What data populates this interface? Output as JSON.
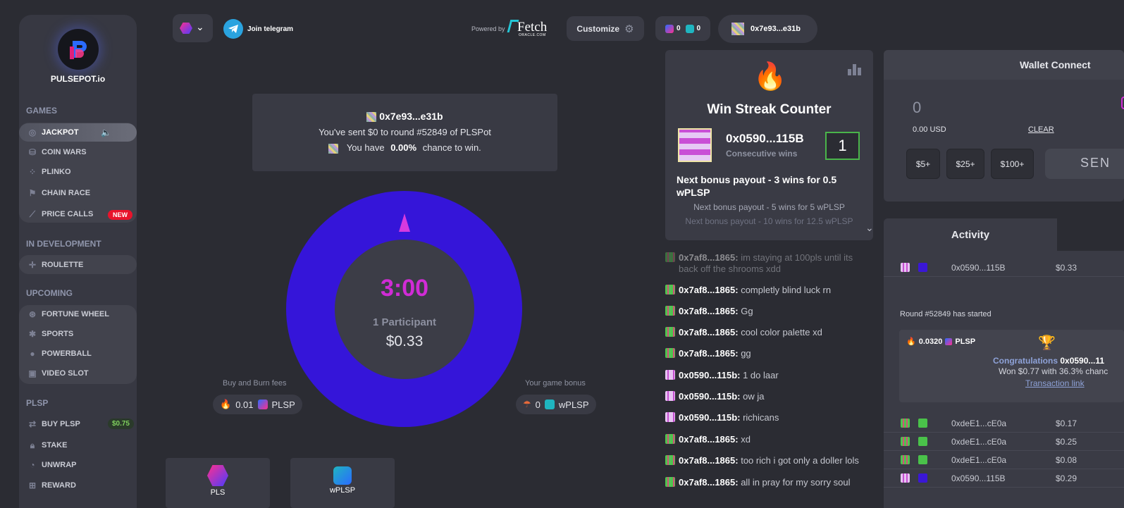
{
  "sidebar": {
    "brand": "PULSEPOT.io",
    "sections": {
      "games": "GAMES",
      "in_dev": "IN DEVELOPMENT",
      "upcoming": "UPCOMING",
      "plsp": "PLSP"
    },
    "games": [
      {
        "label": "JACKPOT",
        "icon": "target-icon"
      },
      {
        "label": "COIN WARS",
        "icon": "coin-icon"
      },
      {
        "label": "PLINKO",
        "icon": "plinko-icon"
      },
      {
        "label": "CHAIN RACE",
        "icon": "flag-icon"
      },
      {
        "label": "PRICE CALLS",
        "icon": "chart-icon",
        "badge": "NEW"
      }
    ],
    "in_dev": [
      {
        "label": "ROULETTE",
        "icon": "roulette-icon"
      }
    ],
    "upcoming": [
      {
        "label": "FORTUNE WHEEL",
        "icon": "wheel-icon"
      },
      {
        "label": "SPORTS",
        "icon": "runner-icon"
      },
      {
        "label": "POWERBALL",
        "icon": "ball-icon"
      },
      {
        "label": "VIDEO SLOT",
        "icon": "slot-icon"
      }
    ],
    "plsp": [
      {
        "label": "BUY PLSP",
        "icon": "buy-icon",
        "badge": "$0.75"
      },
      {
        "label": "STAKE",
        "icon": "lock-icon"
      },
      {
        "label": "UNWRAP",
        "icon": "unwrap-icon"
      },
      {
        "label": "REWARD",
        "icon": "gift-icon"
      }
    ]
  },
  "topbar": {
    "telegram": "Join telegram",
    "powered_by": "Powered by",
    "fetch": "Fetch",
    "fetch_sub": "ORACLE.COM",
    "customize": "Customize",
    "balance_plsp": "0",
    "balance_wplsp": "0",
    "wallet_address": "0x7e93...e31b"
  },
  "round": {
    "address": "0x7e93...e31b",
    "sent_text": "You've sent $0 to round #52849 of PLSPot",
    "have_prefix": "You have",
    "chance": "0.00%",
    "have_suffix": "chance to win."
  },
  "wheel": {
    "timer": "3:00",
    "participants": "1 Participant",
    "pot": "$0.33"
  },
  "fees": {
    "burn_label": "Buy and Burn fees",
    "burn_value": "0.01",
    "burn_token": "PLSP",
    "bonus_label": "Your game bonus",
    "bonus_value": "0",
    "bonus_token": "wPLSP"
  },
  "tokens": [
    {
      "label": "PLS"
    },
    {
      "label": "wPLSP"
    }
  ],
  "streak": {
    "title": "Win Streak Counter",
    "address": "0x0590...115B",
    "sub": "Consecutive wins",
    "count": "1",
    "next1": "Next bonus payout - 3 wins for 0.5 wPLSP",
    "next2": "Next bonus payout - 5 wins for 5 wPLSP",
    "next3": "Next bonus payout - 10 wins for 12.5 wPLSP"
  },
  "chat": [
    {
      "user": "0x7af8...1865:",
      "text": "im staying at 100pls until its",
      "av": "green"
    },
    {
      "user": "",
      "text": "back off the shrooms xdd",
      "av": ""
    },
    {
      "user": "0x7af8...1865:",
      "text": "completly blind luck rn",
      "av": "green"
    },
    {
      "user": "0x7af8...1865:",
      "text": "Gg",
      "av": "green"
    },
    {
      "user": "0x7af8...1865:",
      "text": "cool color palette xd",
      "av": "green"
    },
    {
      "user": "0x7af8...1865:",
      "text": "gg",
      "av": "green"
    },
    {
      "user": "0x0590...115b:",
      "text": "1 do laar",
      "av": "pink"
    },
    {
      "user": "0x0590...115b:",
      "text": "ow ja",
      "av": "pink"
    },
    {
      "user": "0x0590...115b:",
      "text": "richicans",
      "av": "pink"
    },
    {
      "user": "0x7af8...1865:",
      "text": "xd",
      "av": "green"
    },
    {
      "user": "0x7af8...1865:",
      "text": "too rich i got only a doller lols",
      "av": "green"
    },
    {
      "user": "0x7af8...1865:",
      "text": "all in pray for my sorry soul",
      "av": "green"
    }
  ],
  "wallet": {
    "title": "Wallet Connect",
    "amount": "0",
    "usd": "0.00 USD",
    "clear": "CLEAR",
    "presets": [
      "$5+",
      "$25+",
      "$100+"
    ],
    "send": "SEN"
  },
  "activity": {
    "tab": "Activity",
    "first_row": {
      "address": "0x0590...115B",
      "amount": "$0.33",
      "color": "#3a17d6"
    },
    "round_started": "Round #52849 has started",
    "win": {
      "amount": "0.0320",
      "token": "PLSP",
      "congrats": "Congratulations",
      "winner": "0x0590...11",
      "won": "Won $0.77 with 36.3% chanc",
      "link": "Transaction link"
    },
    "rows": [
      {
        "address": "0xdeE1...cE0a",
        "amount": "$0.17",
        "color": "#4ac24a"
      },
      {
        "address": "0xdeE1...cE0a",
        "amount": "$0.25",
        "color": "#4ac24a"
      },
      {
        "address": "0xdeE1...cE0a",
        "amount": "$0.08",
        "color": "#4ac24a"
      },
      {
        "address": "0x0590...115B",
        "amount": "$0.29",
        "color": "#3a17d6"
      }
    ]
  }
}
